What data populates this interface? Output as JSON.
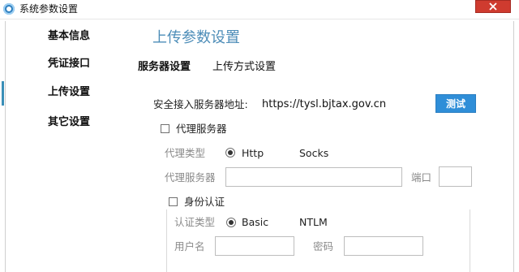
{
  "window": {
    "title": "系统参数设置"
  },
  "sidebar": {
    "items": [
      {
        "label": "基本信息"
      },
      {
        "label": "凭证接口"
      },
      {
        "label": "上传设置"
      },
      {
        "label": "其它设置"
      }
    ]
  },
  "main": {
    "title": "上传参数设置",
    "tabs": [
      {
        "label": "服务器设置"
      },
      {
        "label": "上传方式设置"
      }
    ],
    "server": {
      "address_label": "安全接入服务器地址:",
      "address_value": "https://tysl.bjtax.gov.cn",
      "test_button": "测试"
    },
    "proxy": {
      "enable_label": "代理服务器",
      "type_label": "代理类型",
      "type_options": [
        "Http",
        "Socks"
      ],
      "type_selected": "Http",
      "server_label": "代理服务器",
      "server_value": "",
      "port_label": "端口",
      "port_value": ""
    },
    "auth": {
      "enable_label": "身份认证",
      "type_label": "认证类型",
      "type_options": [
        "Basic",
        "NTLM"
      ],
      "type_selected": "Basic",
      "username_label": "用户名",
      "username_value": "",
      "password_label": "密码",
      "password_value": ""
    }
  },
  "colors": {
    "accent": "#4d8db8",
    "test_button": "#2f8ed8",
    "close_button": "#cf3b2f"
  }
}
